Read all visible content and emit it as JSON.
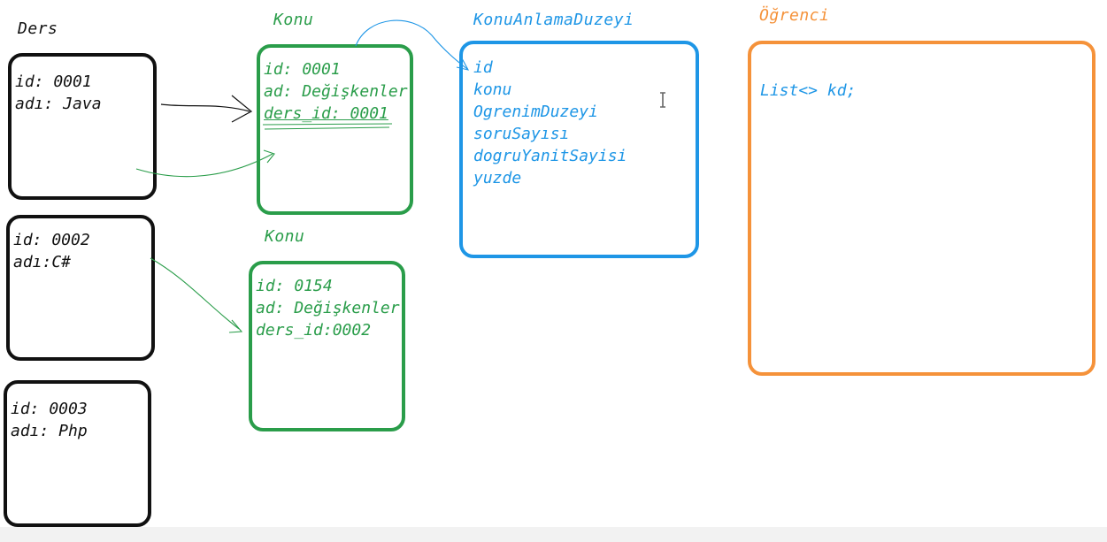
{
  "ders": {
    "title": "Ders",
    "boxes": [
      {
        "id_line": "id: 0001",
        "name_line": "adı: Java"
      },
      {
        "id_line": "id: 0002",
        "name_line": "adı:C#"
      },
      {
        "id_line": "id:  0003",
        "name_line": "adı: Php"
      }
    ]
  },
  "konu": {
    "title1": "Konu",
    "box1": {
      "id_line": "id: 0001",
      "ad_line": "ad: Değişkenler",
      "ders_line": "ders_id: 0001"
    },
    "title2": "Konu",
    "box2": {
      "id_line": "id: 0154",
      "ad_line": "ad: Değişkenler",
      "ders_line": "ders_id:0002"
    }
  },
  "konu_anlama": {
    "title": "KonuAnlamaDuzeyi",
    "fields": [
      "id",
      "konu",
      "OgrenimDuzeyi",
      "soruSayısı",
      "dogruYanitSayisi",
      "yuzde"
    ]
  },
  "ogrenci": {
    "title": "Öğrenci",
    "fields": [
      "List<> kd;"
    ]
  },
  "colors": {
    "ders": "#111111",
    "konu": "#2a9d4a",
    "konu_anlama": "#1e96e6",
    "ogrenci": "#f5923a"
  },
  "icons": {
    "cursor": "text-cursor-icon"
  }
}
